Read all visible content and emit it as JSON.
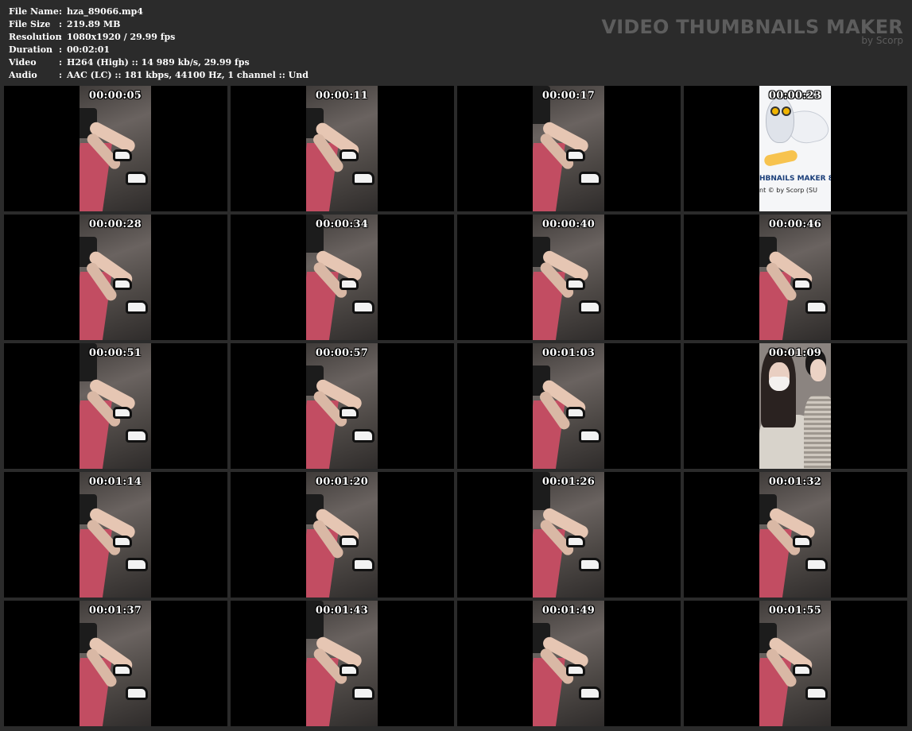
{
  "info": {
    "rows": [
      {
        "label": "File Name",
        "value": "hza_89066.mp4"
      },
      {
        "label": "File Size",
        "value": "219.89 MB"
      },
      {
        "label": "Resolution",
        "value": "1080x1920 / 29.99 fps"
      },
      {
        "label": "Duration",
        "value": "00:02:01"
      },
      {
        "label": "Video",
        "value": "H264 (High) :: 14 989 kb/s, 29.99 fps"
      },
      {
        "label": "Audio",
        "value": "AAC (LC) :: 181 kbps, 44100 Hz, 1 channel :: Und"
      }
    ],
    "separator": ":"
  },
  "brand": {
    "title": "VIDEO THUMBNAILS MAKER",
    "subtitle": "by Scorp"
  },
  "owl_frame": {
    "caption": "HBNAILS MAKER 8",
    "copyright": "nt © by Scorp (SU"
  },
  "thumbnails": [
    {
      "time": "00:00:05",
      "kind": "legs"
    },
    {
      "time": "00:00:11",
      "kind": "legs"
    },
    {
      "time": "00:00:17",
      "kind": "legs"
    },
    {
      "time": "00:00:23",
      "kind": "owl"
    },
    {
      "time": "00:00:28",
      "kind": "legs"
    },
    {
      "time": "00:00:34",
      "kind": "legs"
    },
    {
      "time": "00:00:40",
      "kind": "legs"
    },
    {
      "time": "00:00:46",
      "kind": "legs"
    },
    {
      "time": "00:00:51",
      "kind": "legs"
    },
    {
      "time": "00:00:57",
      "kind": "legs"
    },
    {
      "time": "00:01:03",
      "kind": "legs"
    },
    {
      "time": "00:01:09",
      "kind": "people"
    },
    {
      "time": "00:01:14",
      "kind": "legs"
    },
    {
      "time": "00:01:20",
      "kind": "legs"
    },
    {
      "time": "00:01:26",
      "kind": "legs"
    },
    {
      "time": "00:01:32",
      "kind": "legs"
    },
    {
      "time": "00:01:37",
      "kind": "legs"
    },
    {
      "time": "00:01:43",
      "kind": "legs"
    },
    {
      "time": "00:01:49",
      "kind": "legs"
    },
    {
      "time": "00:01:55",
      "kind": "legs"
    }
  ],
  "colors": {
    "background": "#2b2b2b",
    "cell_background": "#000000",
    "brand_text": "#5d5d5d",
    "info_text": "#ffffff",
    "bench": "#c24d62"
  }
}
